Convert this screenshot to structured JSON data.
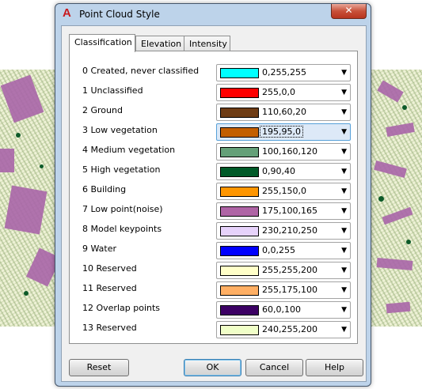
{
  "window": {
    "title": "Point Cloud Style",
    "close_glyph": "✕"
  },
  "app_icon": {
    "glyph": "A",
    "icon": "autocad-logo-icon"
  },
  "tabs": [
    {
      "label": "Classification",
      "active": true
    },
    {
      "label": "Elevation",
      "active": false
    },
    {
      "label": "Intensity",
      "active": false
    }
  ],
  "classifications": [
    {
      "label": "0 Created, never classified",
      "value": "0,255,255",
      "color": "#00ffff"
    },
    {
      "label": "1 Unclassified",
      "value": "255,0,0",
      "color": "#ff0000"
    },
    {
      "label": "2 Ground",
      "value": "110,60,20",
      "color": "#6e3c14"
    },
    {
      "label": "3 Low vegetation",
      "value": "195,95,0",
      "color": "#c35f00",
      "focused": true
    },
    {
      "label": "4 Medium vegetation",
      "value": "100,160,120",
      "color": "#64a078"
    },
    {
      "label": "5 High vegetation",
      "value": "0,90,40",
      "color": "#005a28"
    },
    {
      "label": "6 Building",
      "value": "255,150,0",
      "color": "#ff9600"
    },
    {
      "label": "7 Low point(noise)",
      "value": "175,100,165",
      "color": "#af64a5"
    },
    {
      "label": "8 Model keypoints",
      "value": "230,210,250",
      "color": "#e6d2fa"
    },
    {
      "label": "9 Water",
      "value": "0,0,255",
      "color": "#0000ff"
    },
    {
      "label": "10 Reserved",
      "value": "255,255,200",
      "color": "#ffffc8"
    },
    {
      "label": "11 Reserved",
      "value": "255,175,100",
      "color": "#ffaf64"
    },
    {
      "label": "12 Overlap points",
      "value": "60,0,100",
      "color": "#3c0064"
    },
    {
      "label": "13 Reserved",
      "value": "240,255,200",
      "color": "#f0ffc8"
    }
  ],
  "dropdown_arrow": "▼",
  "buttons": {
    "reset": "Reset",
    "ok": "OK",
    "cancel": "Cancel",
    "help": "Help"
  }
}
